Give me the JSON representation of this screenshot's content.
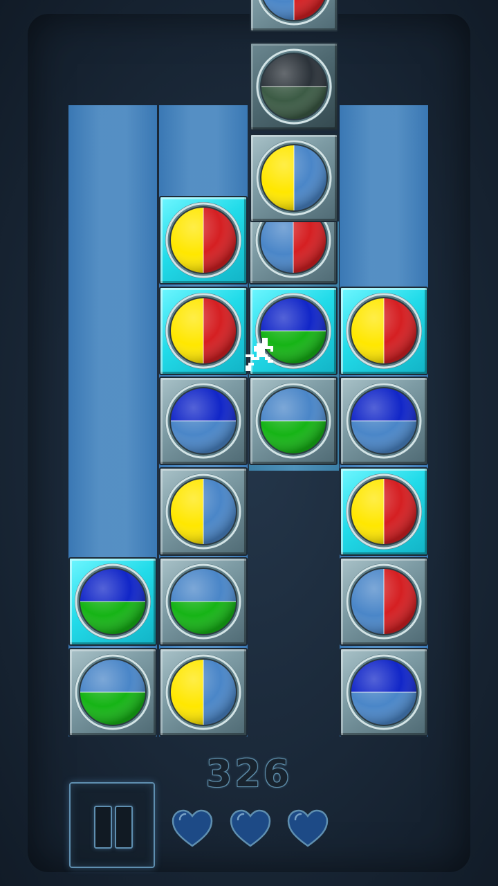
{
  "score": "326",
  "lives": 3,
  "colors": {
    "red": "#d51f22",
    "yellow": "#ffe700",
    "blue": "#1126c8",
    "green": "#16b416",
    "empty": "#4a86c8",
    "grey_tile": "#7d9ba4",
    "cyan_tile": "#22dbe9"
  },
  "icons": {
    "pause": "pause-icon",
    "life": "heart-icon",
    "player": "runner-icon"
  },
  "board": {
    "columns": 4,
    "column_heights": [
      2,
      6,
      3,
      5
    ],
    "placed_tiles": [
      {
        "col": 0,
        "row": 0,
        "tile": "grey",
        "split": "h",
        "a": "empty",
        "b": "green"
      },
      {
        "col": 0,
        "row": 1,
        "tile": "cyan",
        "split": "h",
        "a": "blue",
        "b": "green"
      },
      {
        "col": 1,
        "row": 0,
        "tile": "grey",
        "split": "v",
        "a": "yellow",
        "b": "empty"
      },
      {
        "col": 1,
        "row": 1,
        "tile": "grey",
        "split": "h",
        "a": "empty",
        "b": "green"
      },
      {
        "col": 1,
        "row": 2,
        "tile": "grey",
        "split": "v",
        "a": "yellow",
        "b": "empty"
      },
      {
        "col": 1,
        "row": 3,
        "tile": "grey",
        "split": "h",
        "a": "blue",
        "b": "empty"
      },
      {
        "col": 1,
        "row": 4,
        "tile": "cyan",
        "split": "v",
        "a": "yellow",
        "b": "red"
      },
      {
        "col": 1,
        "row": 5,
        "tile": "cyan",
        "split": "v",
        "a": "yellow",
        "b": "red"
      },
      {
        "col": 2,
        "row": 3,
        "tile": "grey",
        "split": "h",
        "a": "empty",
        "b": "green"
      },
      {
        "col": 2,
        "row": 4,
        "tile": "cyan",
        "split": "h",
        "a": "blue",
        "b": "green"
      },
      {
        "col": 2,
        "row": 5,
        "tile": "grey",
        "split": "v",
        "a": "empty",
        "b": "red"
      },
      {
        "col": 3,
        "row": 0,
        "tile": "grey",
        "split": "h",
        "a": "blue",
        "b": "empty"
      },
      {
        "col": 3,
        "row": 1,
        "tile": "grey",
        "split": "v",
        "a": "empty",
        "b": "red"
      },
      {
        "col": 3,
        "row": 2,
        "tile": "cyan",
        "split": "v",
        "a": "yellow",
        "b": "red"
      },
      {
        "col": 3,
        "row": 3,
        "tile": "grey",
        "split": "h",
        "a": "blue",
        "b": "empty"
      },
      {
        "col": 3,
        "row": 4,
        "tile": "cyan",
        "split": "v",
        "a": "yellow",
        "b": "red"
      }
    ],
    "falling_tiles": [
      {
        "tile": "grey",
        "split": "v",
        "a": "empty",
        "b": "red"
      },
      {
        "tile": "dim",
        "split": "h",
        "a": "dark",
        "b": "darkgreen"
      },
      {
        "tile": "grey",
        "split": "v",
        "a": "yellow",
        "b": "empty"
      }
    ]
  }
}
